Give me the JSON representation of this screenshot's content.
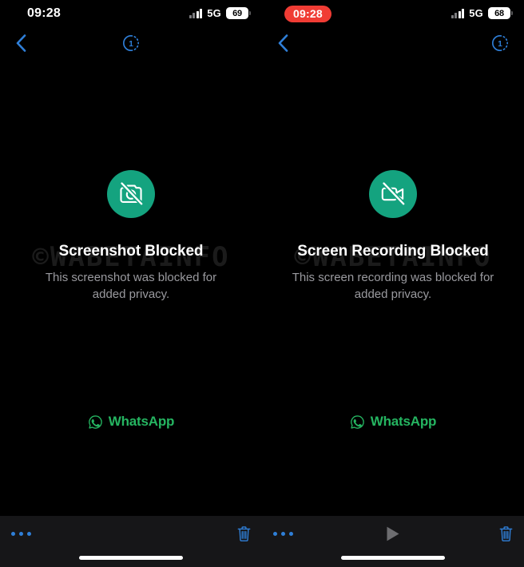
{
  "theme": {
    "background": "#000000",
    "toolbar_bg": "#161618",
    "accent_blue": "#2f7fd8",
    "badge_green": "#14a37f",
    "brand_green": "#25b561",
    "recording_red": "#f03c34",
    "title_color": "#ffffff",
    "subtitle_color": "#9a9a9f",
    "watermark_color": "#1b1b1b"
  },
  "watermark": {
    "text": "©WABETAINFO"
  },
  "panels": [
    {
      "id": "screenshot-blocked",
      "status_bar": {
        "time": "09:28",
        "time_is_recording_pill": false,
        "network": "5G",
        "battery_level": "69",
        "signal_bars_filled": 2,
        "signal_bars_total": 4
      },
      "nav_bar": {
        "back_icon": "chevron-left-icon",
        "view_once_icon": "view-once-icon",
        "view_once_label": "1"
      },
      "body": {
        "badge_icon": "camera-slash-icon",
        "title": "Screenshot Blocked",
        "subtitle": "This screenshot was blocked for added privacy."
      },
      "brand": {
        "icon": "whatsapp-icon",
        "name": "WhatsApp"
      },
      "toolbar": {
        "more_label": "•••",
        "more_icon": "more-dots-icon",
        "play_icon": null,
        "delete_icon": "trash-icon"
      }
    },
    {
      "id": "screen-recording-blocked",
      "status_bar": {
        "time": "09:28",
        "time_is_recording_pill": true,
        "network": "5G",
        "battery_level": "68",
        "signal_bars_filled": 2,
        "signal_bars_total": 4
      },
      "nav_bar": {
        "back_icon": "chevron-left-icon",
        "view_once_icon": "view-once-icon",
        "view_once_label": "1"
      },
      "body": {
        "badge_icon": "video-slash-icon",
        "title": "Screen Recording Blocked",
        "subtitle": "This screen recording was blocked for added privacy."
      },
      "brand": {
        "icon": "whatsapp-icon",
        "name": "WhatsApp"
      },
      "toolbar": {
        "more_label": "•••",
        "more_icon": "more-dots-icon",
        "play_icon": "play-icon",
        "delete_icon": "trash-icon"
      }
    }
  ]
}
